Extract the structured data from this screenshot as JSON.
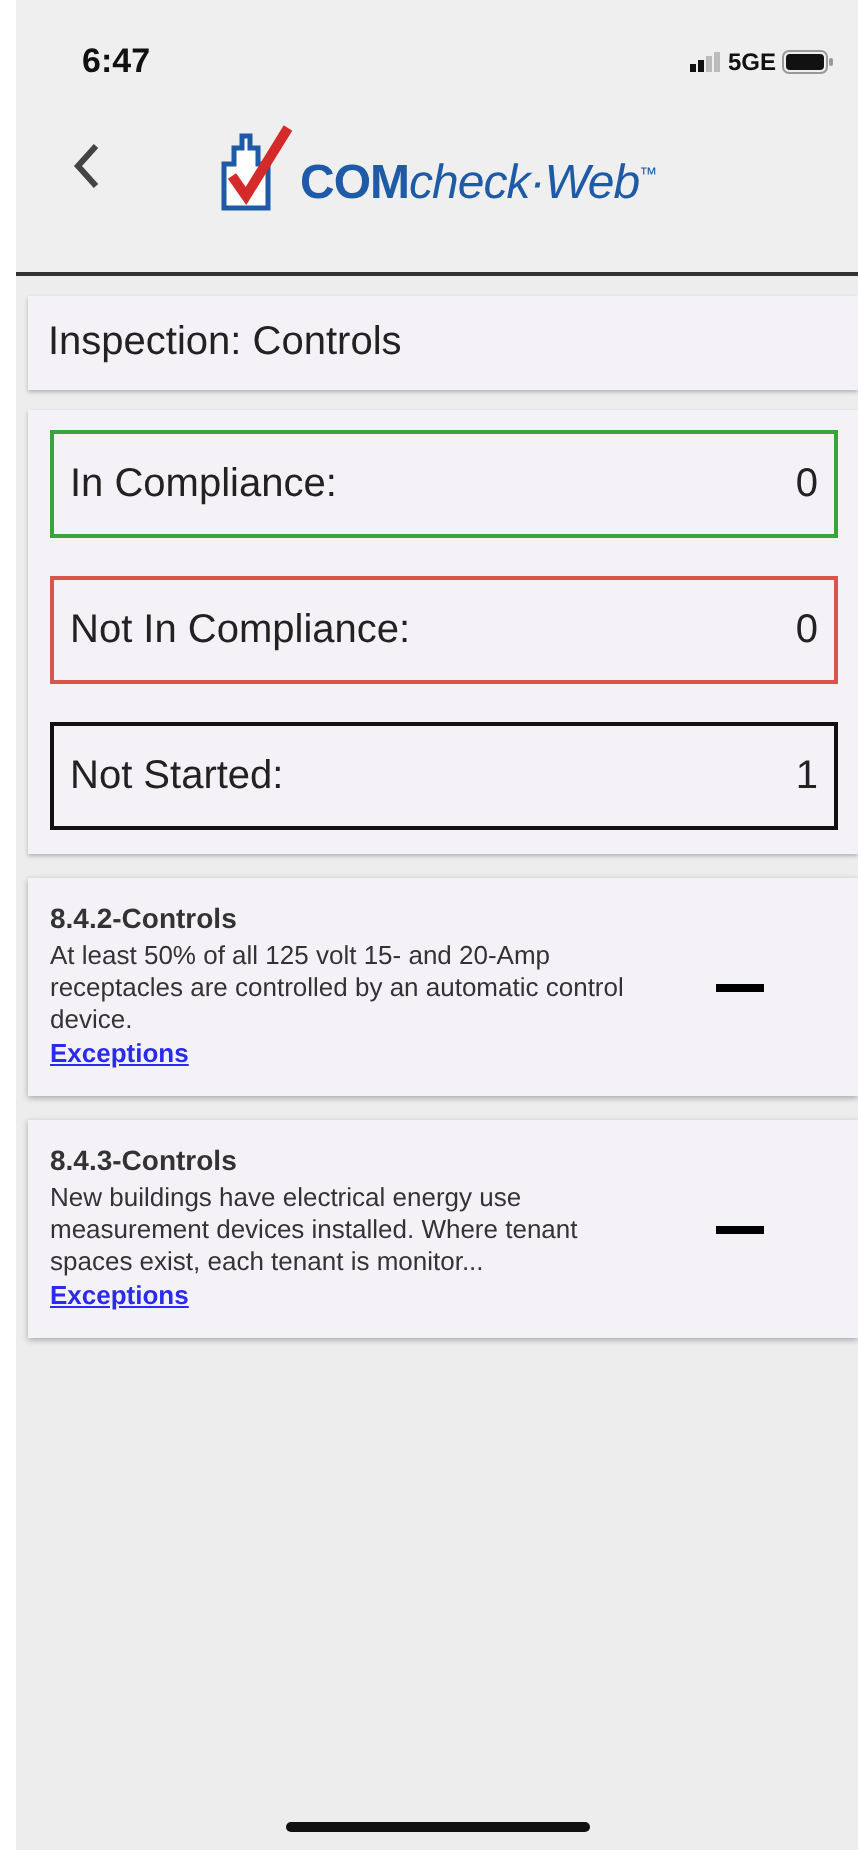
{
  "status_bar": {
    "time": "6:47",
    "network": "5GE"
  },
  "header": {
    "logo_bold": "COM",
    "logo_italic": "check·Web",
    "trademark": "™"
  },
  "page_title": "Inspection: Controls",
  "summary": [
    {
      "label": "In Compliance:",
      "count": "0",
      "color": "#3aa33a"
    },
    {
      "label": "Not In Compliance:",
      "count": "0",
      "color": "#d9534f"
    },
    {
      "label": "Not Started:",
      "count": "1",
      "color": "#111111"
    }
  ],
  "requirements": [
    {
      "title": "8.4.2-Controls",
      "description": "At least 50% of all 125 volt 15- and 20-Amp receptacles are controlled by an automatic control device.",
      "link": "Exceptions",
      "kind": "dash"
    },
    {
      "title": "8.4.3-Controls",
      "description": "New buildings have electrical energy use measurement devices installed. Where tenant spaces exist, each tenant is monitor...",
      "link": "Exceptions",
      "kind": "dash"
    }
  ]
}
